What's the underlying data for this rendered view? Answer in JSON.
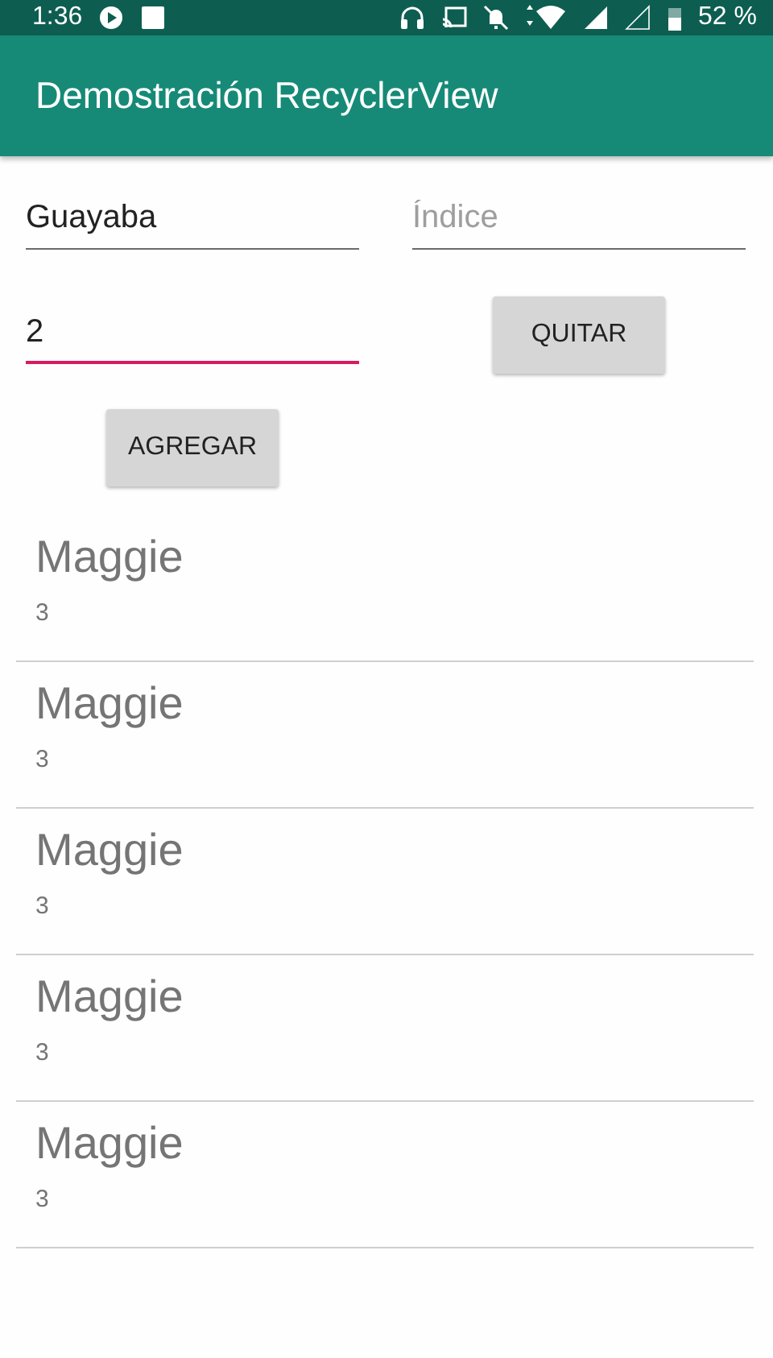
{
  "status_bar": {
    "time": "1:36",
    "battery": "52 %"
  },
  "app_bar": {
    "title": "Demostración RecyclerView"
  },
  "form": {
    "name_field": {
      "value": "Guayaba",
      "focused": false
    },
    "index_field": {
      "placeholder": "Índice",
      "focused": false
    },
    "amount_field": {
      "value": "2",
      "focused": true
    },
    "remove_button": "QUITAR",
    "add_button": "AGREGAR"
  },
  "list": [
    {
      "title": "Maggie",
      "subtitle": "3"
    },
    {
      "title": "Maggie",
      "subtitle": "3"
    },
    {
      "title": "Maggie",
      "subtitle": "3"
    },
    {
      "title": "Maggie",
      "subtitle": "3"
    },
    {
      "title": "Maggie",
      "subtitle": "3"
    }
  ]
}
